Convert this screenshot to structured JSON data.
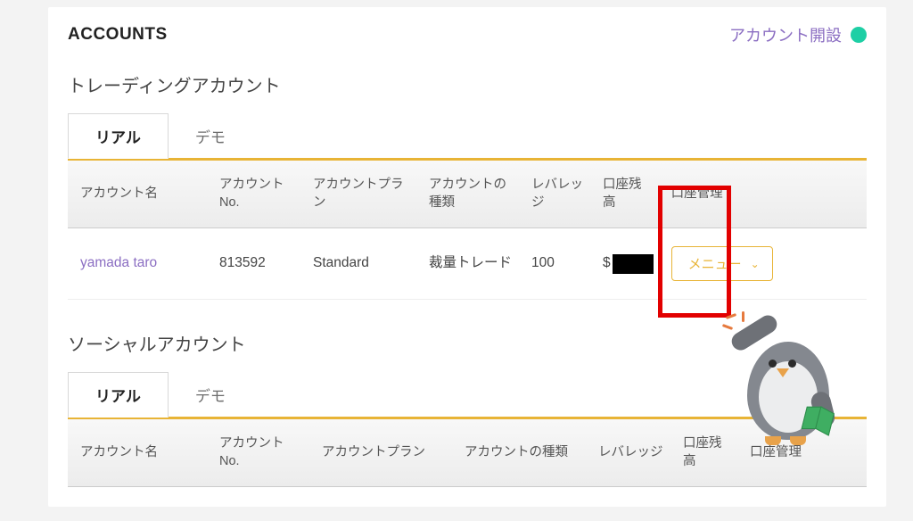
{
  "header": {
    "title": "ACCOUNTS",
    "create_label": "アカウント開設"
  },
  "trading": {
    "title": "トレーディングアカウント",
    "tabs": {
      "real": "リアル",
      "demo": "デモ"
    },
    "columns": {
      "name": "アカウント名",
      "no": "アカウントNo.",
      "plan": "アカウントプラン",
      "type": "アカウントの種類",
      "leverage": "レバレッジ",
      "balance": "口座残高",
      "manage": "口座管理"
    },
    "rows": [
      {
        "name": "yamada taro",
        "no": "813592",
        "plan": "Standard",
        "type": "裁量トレード",
        "leverage": "100",
        "balance_prefix": "$",
        "menu_label": "メニュー"
      }
    ]
  },
  "social": {
    "title": "ソーシャルアカウント",
    "tabs": {
      "real": "リアル",
      "demo": "デモ"
    },
    "columns": {
      "name": "アカウント名",
      "no": "アカウントNo.",
      "plan": "アカウントプラン",
      "type": "アカウントの種類",
      "leverage": "レバレッジ",
      "balance": "口座残高",
      "manage": "口座管理"
    }
  }
}
